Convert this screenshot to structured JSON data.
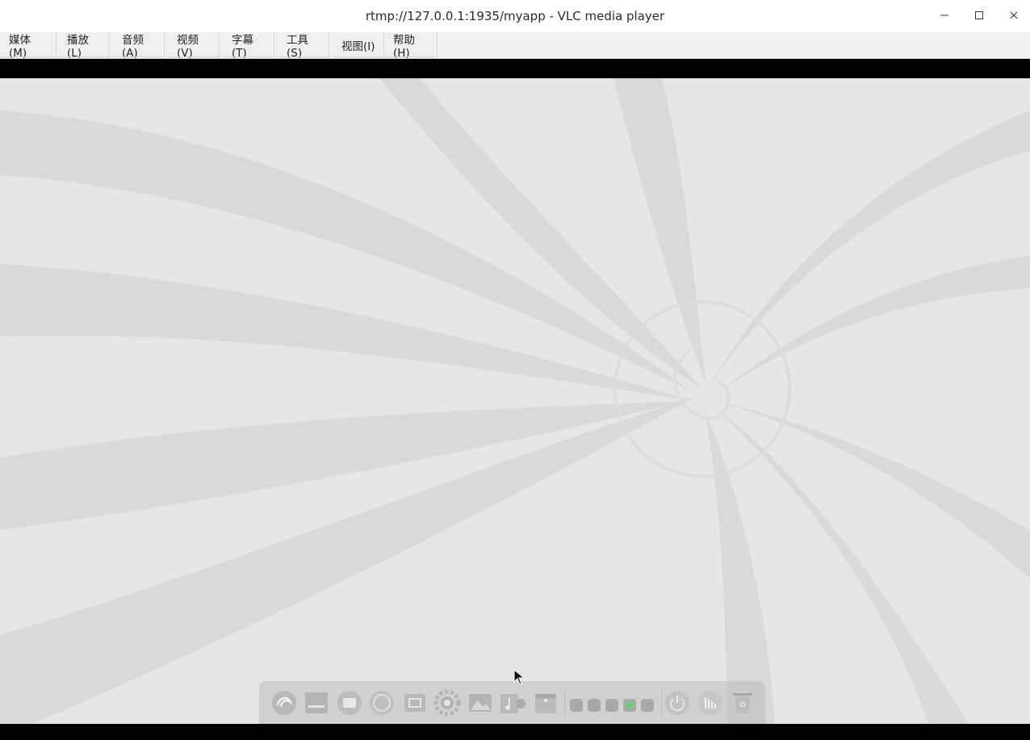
{
  "window": {
    "title": "rtmp://127.0.0.1:1935/myapp - VLC media player",
    "minimize_icon": "minimize-icon",
    "maximize_icon": "maximize-icon",
    "close_icon": "close-icon"
  },
  "menu": {
    "items": [
      {
        "label": "媒体(M)"
      },
      {
        "label": "播放(L)"
      },
      {
        "label": "音频(A)"
      },
      {
        "label": "视频(V)"
      },
      {
        "label": "字幕(T)"
      },
      {
        "label": "工具(S)"
      },
      {
        "label": "视图(I)"
      },
      {
        "label": "帮助(H)"
      }
    ]
  },
  "video": {
    "content": "desktop-wallpaper-swirl",
    "background_color": "#e5e5e5",
    "letterbox_color": "#000000"
  },
  "dock": {
    "apps": [
      "launcher-icon",
      "file-manager-icon",
      "video-app-icon",
      "browser-icon",
      "screenshot-icon",
      "settings-icon",
      "image-viewer-icon",
      "music-icon",
      "store-icon"
    ],
    "tray": [
      "tray-keyboard-icon",
      "tray-expand-icon",
      "tray-display-icon",
      "tray-network-icon",
      "tray-collapse-icon"
    ],
    "system": [
      "power-icon",
      "audio-icon",
      "trash-icon"
    ]
  }
}
